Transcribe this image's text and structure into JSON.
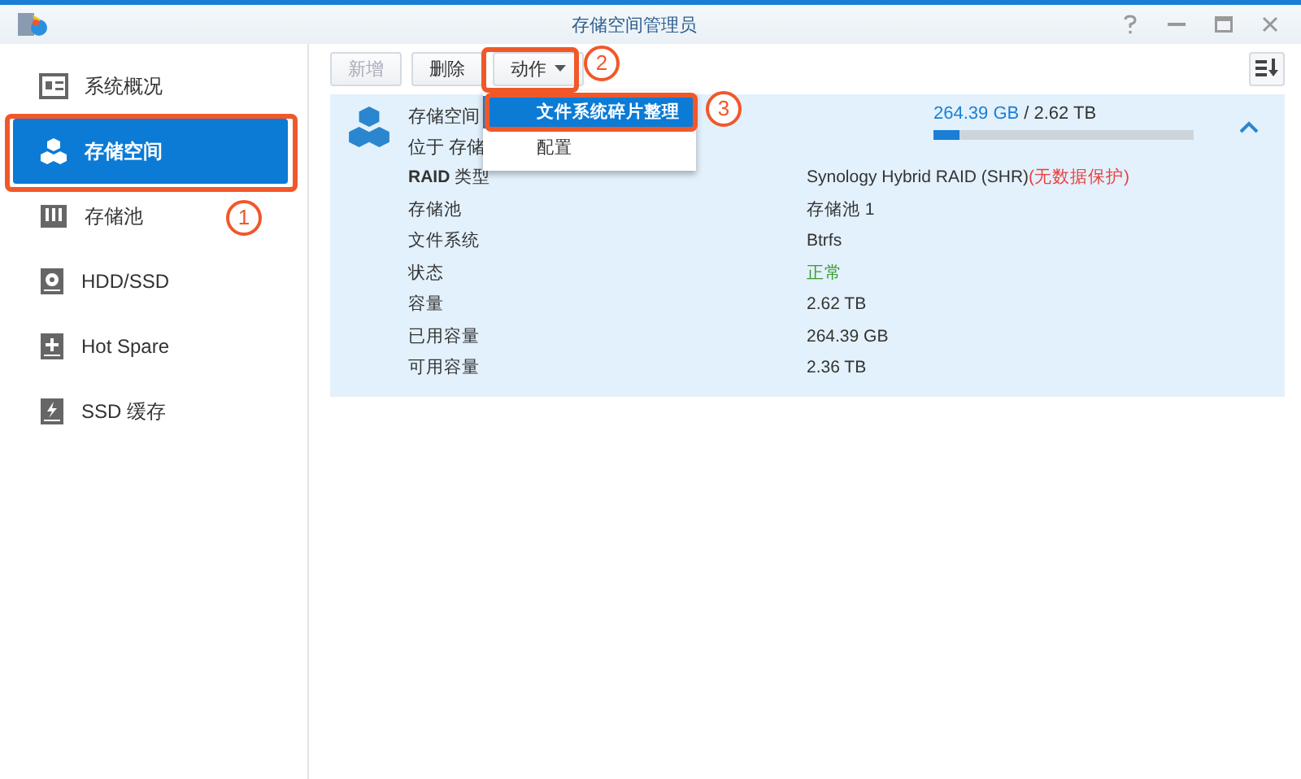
{
  "window": {
    "title": "存储空间管理员"
  },
  "sidebar": {
    "items": [
      {
        "label": "系统概况",
        "selected": false
      },
      {
        "label": "存储空间",
        "selected": true
      },
      {
        "label": "存储池",
        "selected": false
      },
      {
        "label": "HDD/SSD",
        "selected": false
      },
      {
        "label": "Hot Spare",
        "selected": false
      },
      {
        "label": "SSD 缓存",
        "selected": false
      }
    ]
  },
  "toolbar": {
    "buttons": [
      {
        "label": "新增",
        "disabled": true
      },
      {
        "label": "删除",
        "disabled": false
      },
      {
        "label": "动作",
        "disabled": false,
        "dropdown": true
      }
    ]
  },
  "menu": {
    "items": [
      {
        "label": "文件系统碎片整理",
        "selected": true
      },
      {
        "label": "配置",
        "selected": false
      }
    ]
  },
  "volume": {
    "title": "存储空间",
    "subtitle": "位于 存储",
    "used": "264.39 GB",
    "total": " / 2.62 TB",
    "level": 0.1,
    "expanded": true,
    "rows": [
      {
        "label": "**RAID** 类型",
        "value": "Synology Hybrid RAID (SHR)",
        "note": "(无数据保护)",
        "kind": "text"
      },
      {
        "label": "存储池",
        "value": "存储池 1",
        "kind": "text"
      },
      {
        "label": "文件系统",
        "value": "Btrfs",
        "kind": "text"
      },
      {
        "label": "状态",
        "value": "正常",
        "kind": "status"
      },
      {
        "label": "容量",
        "value": "2.62 TB",
        "kind": "text"
      },
      {
        "label": "已用容量",
        "value": "264.39 GB",
        "kind": "text"
      },
      {
        "label": "可用容量",
        "value": "2.36 TB",
        "kind": "text"
      }
    ]
  },
  "annotations": [
    {
      "number": "1"
    },
    {
      "number": "2"
    },
    {
      "number": "3"
    }
  ]
}
